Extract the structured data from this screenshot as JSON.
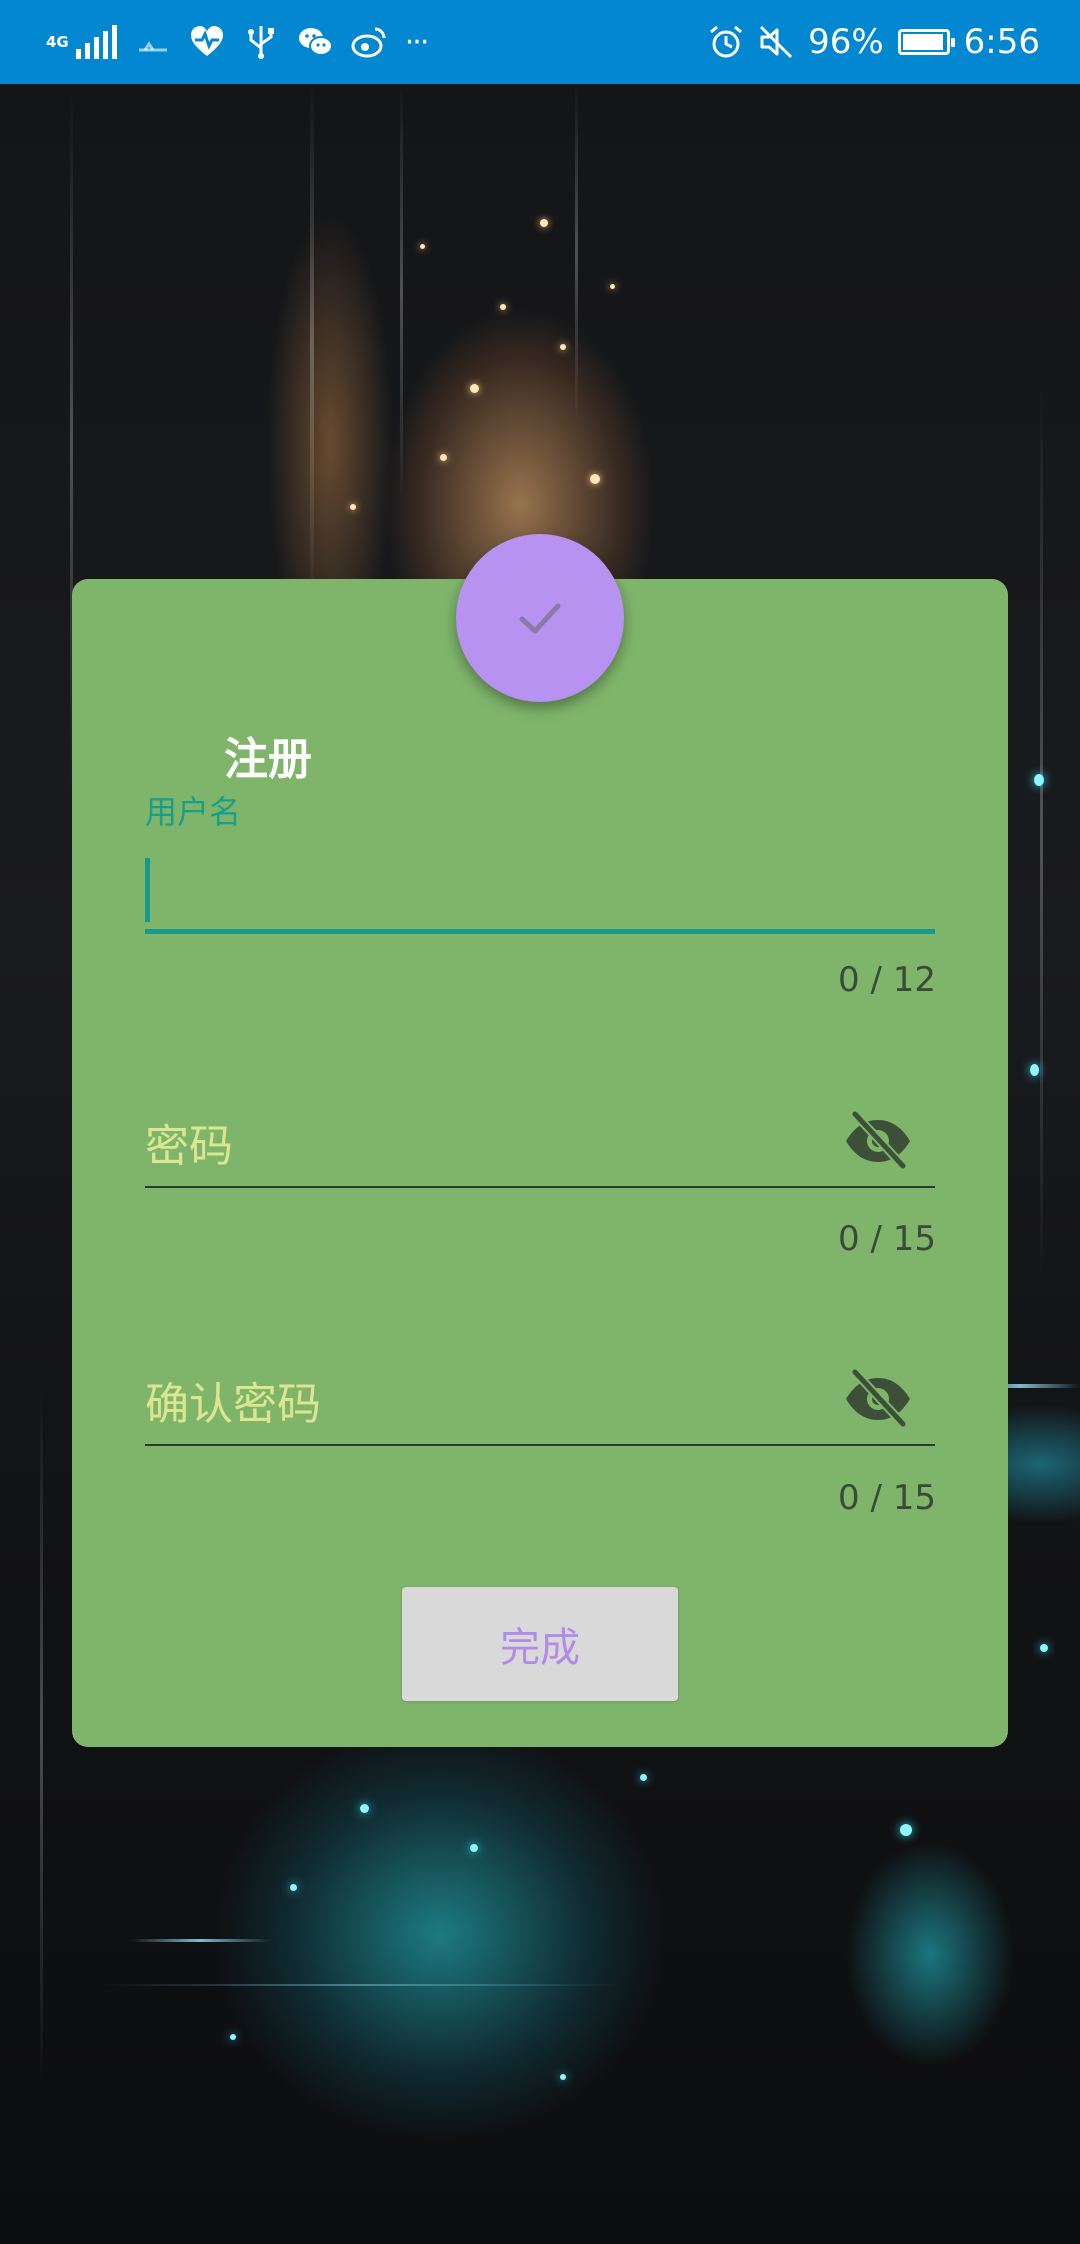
{
  "status_bar": {
    "network_label": "4G",
    "battery_percent": "96%",
    "battery_level": 0.96,
    "time": "6:56",
    "more_indicator": "···",
    "icons_left": [
      "signal-icon",
      "data-activity-icon",
      "heart-rate-icon",
      "usb-icon",
      "wechat-icon",
      "weibo-icon"
    ],
    "icons_right": [
      "alarm-icon",
      "mute-icon",
      "battery-icon"
    ]
  },
  "dialog": {
    "title": "注册",
    "header_icon": "check-icon",
    "colors": {
      "card": "#7fb56b",
      "fab": "#b892f1",
      "accent": "#17988a",
      "button_text": "#b18be8"
    },
    "username": {
      "label": "用户名",
      "value": "",
      "counter": "0 / 12"
    },
    "password": {
      "placeholder": "密码",
      "value": "",
      "counter": "0 / 15",
      "toggle_icon": "eye-off-icon"
    },
    "confirm_password": {
      "placeholder": "确认密码",
      "value": "",
      "counter": "0 / 15",
      "toggle_icon": "eye-off-icon"
    },
    "submit_label": "完成"
  }
}
